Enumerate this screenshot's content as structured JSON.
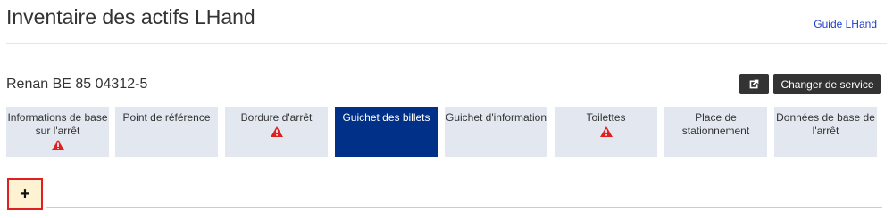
{
  "header": {
    "title": "Inventaire des actifs LHand",
    "guide_link": "Guide LHand"
  },
  "service": {
    "name": "Renan BE 85 04312-5",
    "export_icon": "external-export-icon",
    "change_label": "Changer de service"
  },
  "tabs": [
    {
      "label": "Informations de base sur l'arrêt",
      "warning": true,
      "active": false
    },
    {
      "label": "Point de référence",
      "warning": false,
      "active": false
    },
    {
      "label": "Bordure d'arrêt",
      "warning": true,
      "active": false
    },
    {
      "label": "Guichet des billets",
      "warning": false,
      "active": true
    },
    {
      "label": "Guichet d'information",
      "warning": false,
      "active": false
    },
    {
      "label": "Toilettes",
      "warning": true,
      "active": false
    },
    {
      "label": "Place de stationnement",
      "warning": false,
      "active": false
    },
    {
      "label": "Données de base de l'arrêt",
      "warning": false,
      "active": false
    }
  ],
  "add_button": {
    "label": "+"
  },
  "colors": {
    "accent": "#003087",
    "tab_bg": "#e3e8f0",
    "warning": "#e02020",
    "button_dark": "#333333"
  }
}
